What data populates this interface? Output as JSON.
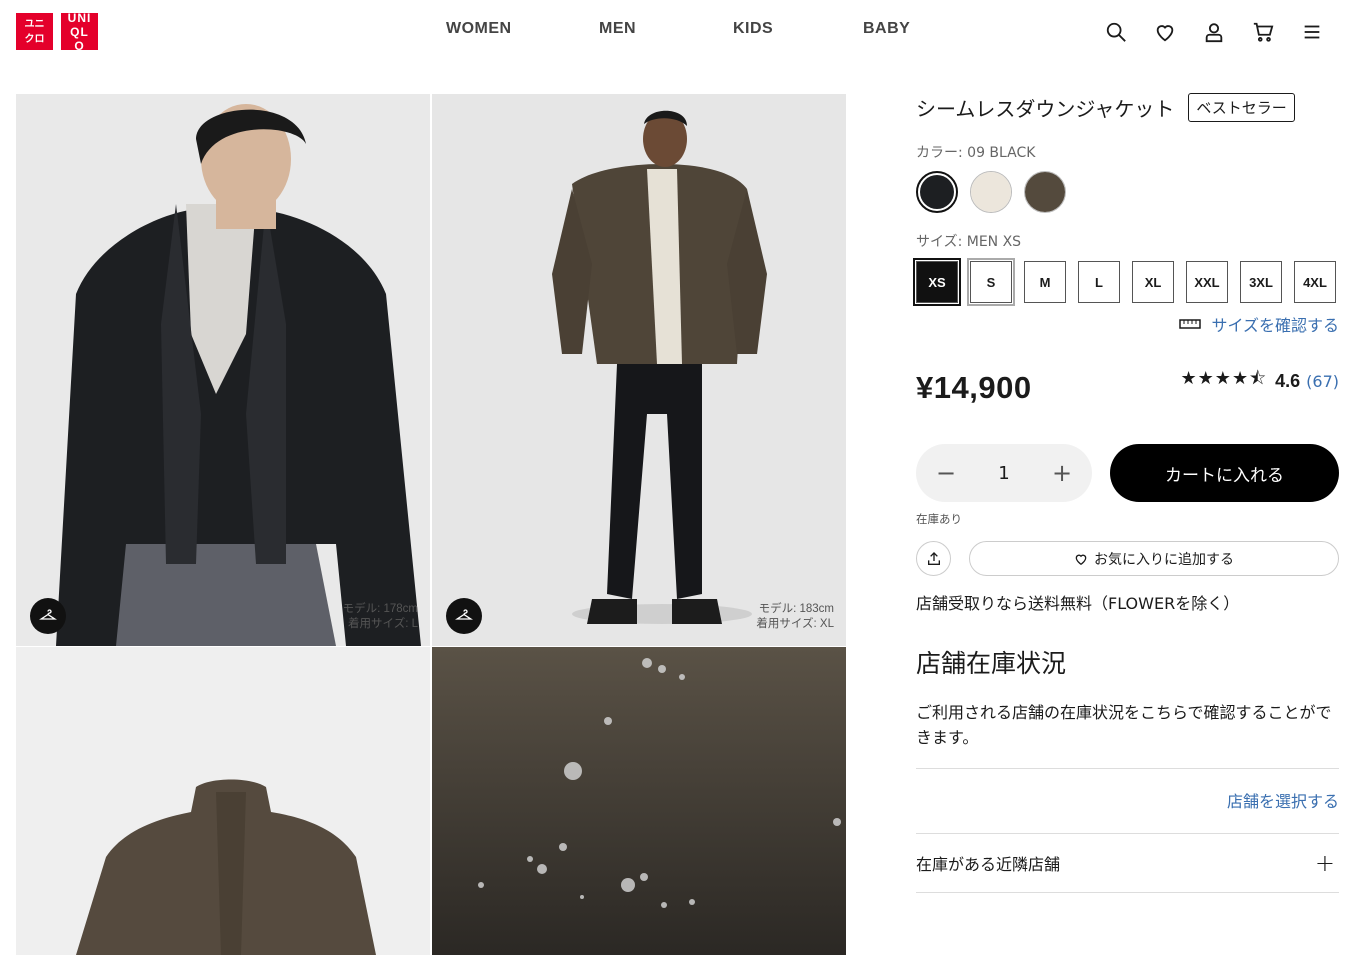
{
  "header": {
    "logo_text_1": "ユニクロ",
    "logo_text_2": "UNIQLO",
    "nav": [
      "WOMEN",
      "MEN",
      "KIDS",
      "BABY"
    ],
    "icons": [
      "search-icon",
      "heart-icon",
      "account-icon",
      "cart-icon",
      "menu-icon"
    ]
  },
  "gallery": {
    "model_1": [
      "モデル: 178cm",
      "着用サイズ: L"
    ],
    "model_2": [
      "モデル: 183cm",
      "着用サイズ: XL"
    ]
  },
  "product": {
    "title": "シームレスダウンジャケット",
    "badge": "ベストセラー",
    "color_label": "カラー: 09 BLACK",
    "colors": [
      {
        "name": "BLACK",
        "hex": "#1d1f22"
      },
      {
        "name": "OFF WHITE",
        "hex": "#ece6dc"
      },
      {
        "name": "OLIVE",
        "hex": "#544a3d"
      }
    ],
    "size_label": "サイズ: MEN XS",
    "sizes": [
      "XS",
      "S",
      "M",
      "L",
      "XL",
      "XXL",
      "3XL",
      "4XL"
    ],
    "size_guide": "サイズを確認する",
    "price": "¥14,900",
    "rating_stars": "★★★★⯪",
    "rating_value": "4.6",
    "rating_count": "(67)",
    "quantity": "1",
    "add_to_cart": "カートに入れる",
    "stock_status": "在庫あり",
    "favorite": "お気に入りに追加する",
    "shipping_note": "店舗受取りなら送料無料（FLOWERを除く）"
  },
  "store": {
    "title": "店舗在庫状況",
    "description": "ご利用される店舗の在庫状況をこちらで確認することができます。",
    "select_store": "店舗を選択する",
    "nearby": "在庫がある近隣店舗"
  }
}
